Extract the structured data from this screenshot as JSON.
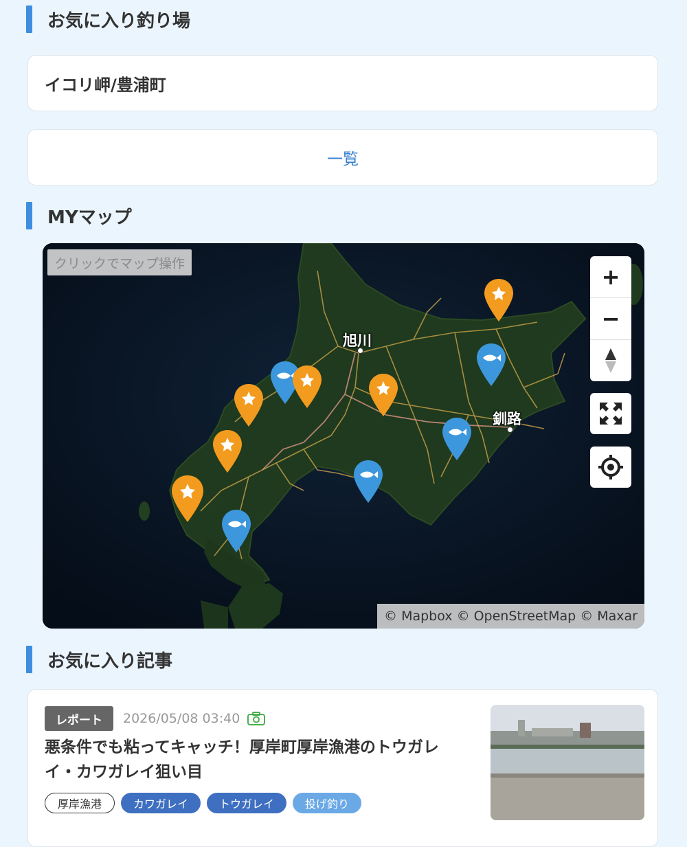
{
  "favorites_section": {
    "title": "お気に入り釣り場"
  },
  "favorite_spot": {
    "name": "イコリ岬/豊浦町"
  },
  "list_button": {
    "label": "一覧"
  },
  "mymap_section": {
    "title": "MYマップ"
  },
  "map": {
    "hint": "クリックでマップ操作",
    "attribution": "© Mapbox © OpenStreetMap © Maxar",
    "cities": [
      {
        "name": "旭川"
      },
      {
        "name": "釧路"
      }
    ],
    "controls": {
      "zoom_in": "+",
      "zoom_out": "−"
    },
    "pins": {
      "favorite_color": "#f29b1f",
      "catch_color": "#3d97dc"
    }
  },
  "articles_section": {
    "title": "お気に入り記事"
  },
  "article": {
    "category": "レポート",
    "date": "2026/05/08 03:40",
    "title": "悪条件でも粘ってキャッチ！厚岸町厚岸漁港のトウガレイ・カワガレイ狙い目",
    "tags": [
      "厚岸漁港",
      "カワガレイ",
      "トウガレイ",
      "投げ釣り"
    ]
  }
}
